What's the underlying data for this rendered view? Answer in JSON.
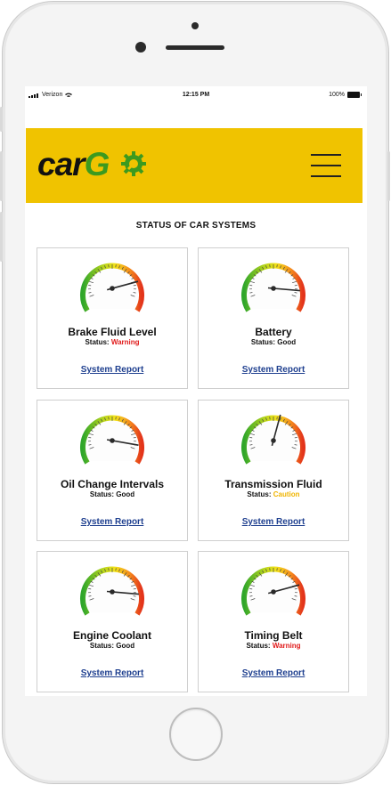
{
  "status_bar": {
    "carrier": "Verizon",
    "time": "12:15 PM",
    "battery": "100%"
  },
  "app": {
    "logo_prefix": "car",
    "logo_suffix": "G",
    "brand_color": "#f0c300"
  },
  "page": {
    "title": "STATUS OF CAR SYSTEMS"
  },
  "colors": {
    "warning": "#e01b1b",
    "good": "#111111",
    "caution": "#f0b400",
    "link": "#1e3f8f"
  },
  "systems": [
    {
      "name": "Brake Fluid Level",
      "status_label": "Status:",
      "status": "Warning",
      "status_type": "warning",
      "link": "System Report",
      "gauge_angle": 15
    },
    {
      "name": "Battery",
      "status_label": "Status:",
      "status": "Good",
      "status_type": "good",
      "link": "System Report",
      "gauge_angle": -5
    },
    {
      "name": "Oil Change Intervals",
      "status_label": "Status:",
      "status": "Good",
      "status_type": "good",
      "link": "System Report",
      "gauge_angle": -10
    },
    {
      "name": "Transmission Fluid",
      "status_label": "Status:",
      "status": "Caution",
      "status_type": "caution",
      "link": "System Report",
      "gauge_angle": 75
    },
    {
      "name": "Engine Coolant",
      "status_label": "Status:",
      "status": "Good",
      "status_type": "good",
      "link": "System Report",
      "gauge_angle": -5
    },
    {
      "name": "Timing Belt",
      "status_label": "Status:",
      "status": "Warning",
      "status_type": "warning",
      "link": "System Report",
      "gauge_angle": 15
    }
  ]
}
